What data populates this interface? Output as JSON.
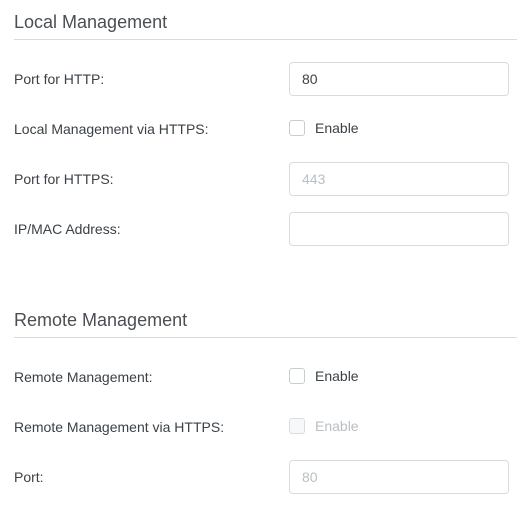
{
  "local": {
    "title": "Local Management",
    "http_port_label": "Port for HTTP:",
    "http_port_value": "80",
    "https_enable_label": "Local Management via HTTPS:",
    "https_enable_text": "Enable",
    "https_port_label": "Port for HTTPS:",
    "https_port_value": "443",
    "ipmac_label": "IP/MAC Address:",
    "ipmac_value": ""
  },
  "remote": {
    "title": "Remote Management",
    "enable_label": "Remote Management:",
    "enable_text": "Enable",
    "https_enable_label": "Remote Management via HTTPS:",
    "https_enable_text": "Enable",
    "port_label": "Port:",
    "port_value": "80"
  }
}
